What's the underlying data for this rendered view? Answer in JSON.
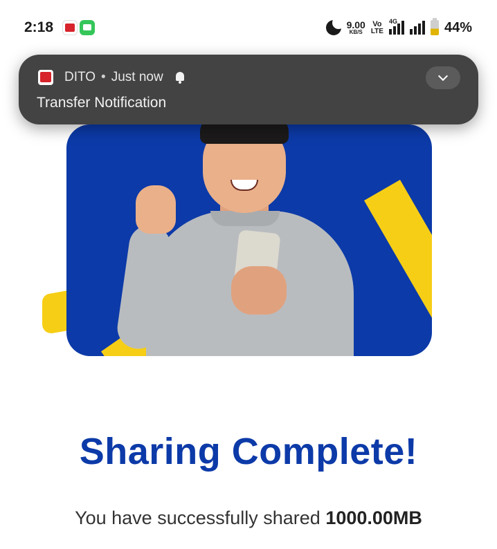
{
  "status_bar": {
    "time": "2:18",
    "net_speed_value": "9.00",
    "net_speed_unit": "KB/S",
    "volte_top": "Vo",
    "volte_bottom": "LTE",
    "network_type": "4G",
    "battery_percent": "44%",
    "battery_level": 0.44,
    "icons": [
      "dito-app-icon",
      "messages-app-icon",
      "do-not-disturb-moon-icon",
      "signal-icon",
      "signal-icon",
      "battery-icon"
    ]
  },
  "notification": {
    "app_name": "DITO",
    "separator": "•",
    "time": "Just now",
    "title": "Transfer Notification",
    "icons": [
      "dito-app-icon",
      "alert-bell-icon",
      "chevron-down-icon"
    ]
  },
  "main": {
    "headline": "Sharing Complete!",
    "message_prefix": "You have successfully shared ",
    "message_amount": "1000.00MB"
  },
  "colors": {
    "brand_blue": "#0c3aa8",
    "accent_yellow": "#f7ce16",
    "notification_bg": "#434343",
    "dito_red": "#d7232b"
  }
}
